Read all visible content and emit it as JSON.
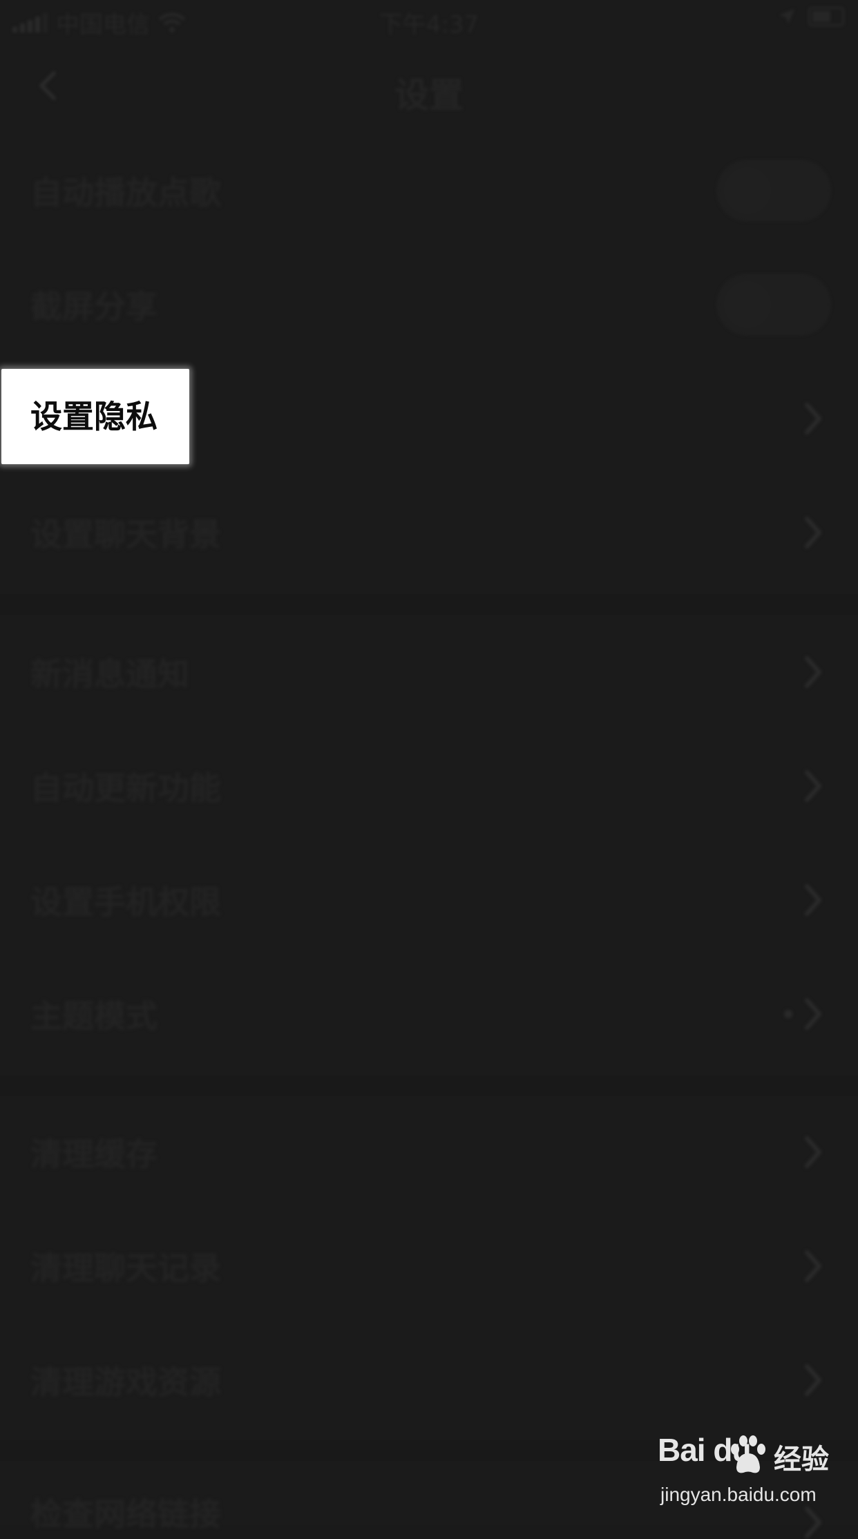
{
  "status_bar": {
    "carrier": "中国电信",
    "time": "下午4:37"
  },
  "nav": {
    "title": "设置"
  },
  "rows": [
    {
      "label": "自动播放点歌",
      "control": "toggle",
      "toggle_on": false
    },
    {
      "label": "截屏分享",
      "control": "toggle",
      "toggle_on": false
    },
    {
      "label": "设置隐私",
      "control": "chevron",
      "highlighted": true
    },
    {
      "label": "设置聊天背景",
      "control": "chevron"
    },
    {
      "label": "新消息通知",
      "control": "chevron"
    },
    {
      "label": "自动更新功能",
      "control": "chevron"
    },
    {
      "label": "设置手机权限",
      "control": "chevron"
    },
    {
      "label": "主题模式",
      "control": "chevron",
      "has_dot": true
    },
    {
      "label": "清理缓存",
      "control": "chevron"
    },
    {
      "label": "清理聊天记录",
      "control": "chevron"
    },
    {
      "label": "清理游戏资源",
      "control": "chevron"
    },
    {
      "label": "检查网络链接",
      "control": "chevron"
    }
  ],
  "watermark": {
    "logo": "Bai du",
    "brand_cn": "经验",
    "url": "jingyan.baidu.com"
  },
  "colors": {
    "overlay_background": "#1b1b1b",
    "highlight_background": "#ffffff",
    "highlight_text": "#0d0d0d"
  }
}
